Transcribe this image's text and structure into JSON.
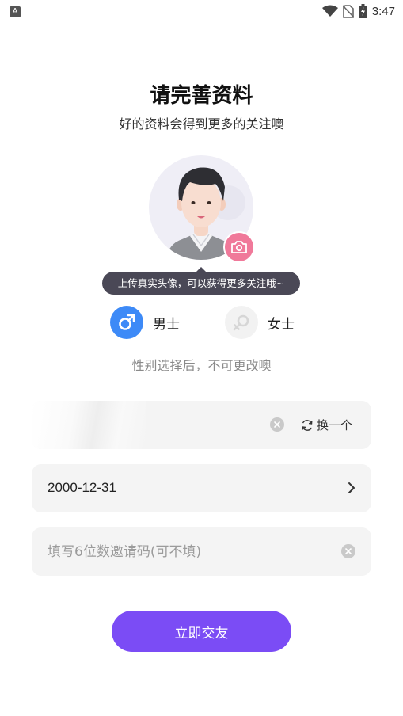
{
  "status_bar": {
    "notification_icon": "A",
    "time": "3:47",
    "icons": [
      "wifi-icon",
      "no-sim-icon",
      "battery-charging-icon"
    ]
  },
  "header": {
    "title": "请完善资料",
    "subtitle": "好的资料会得到更多的关注噢"
  },
  "avatar": {
    "tooltip": "上传真实头像，可以获得更多关注哦~"
  },
  "gender": {
    "male_label": "男士",
    "female_label": "女士",
    "selected": "male",
    "note": "性别选择后，不可更改噢"
  },
  "form": {
    "nickname_value": "",
    "swap_label": "换一个",
    "birthday_value": "2000-12-31",
    "invite_placeholder": "填写6位数邀请码(可不填)",
    "invite_value": ""
  },
  "submit_label": "立即交友",
  "colors": {
    "accent": "#7b4cf5",
    "male": "#3d8af7",
    "camera": "#f0799a",
    "tooltip_bg": "#4a4856",
    "field_bg": "#f4f4f4"
  }
}
